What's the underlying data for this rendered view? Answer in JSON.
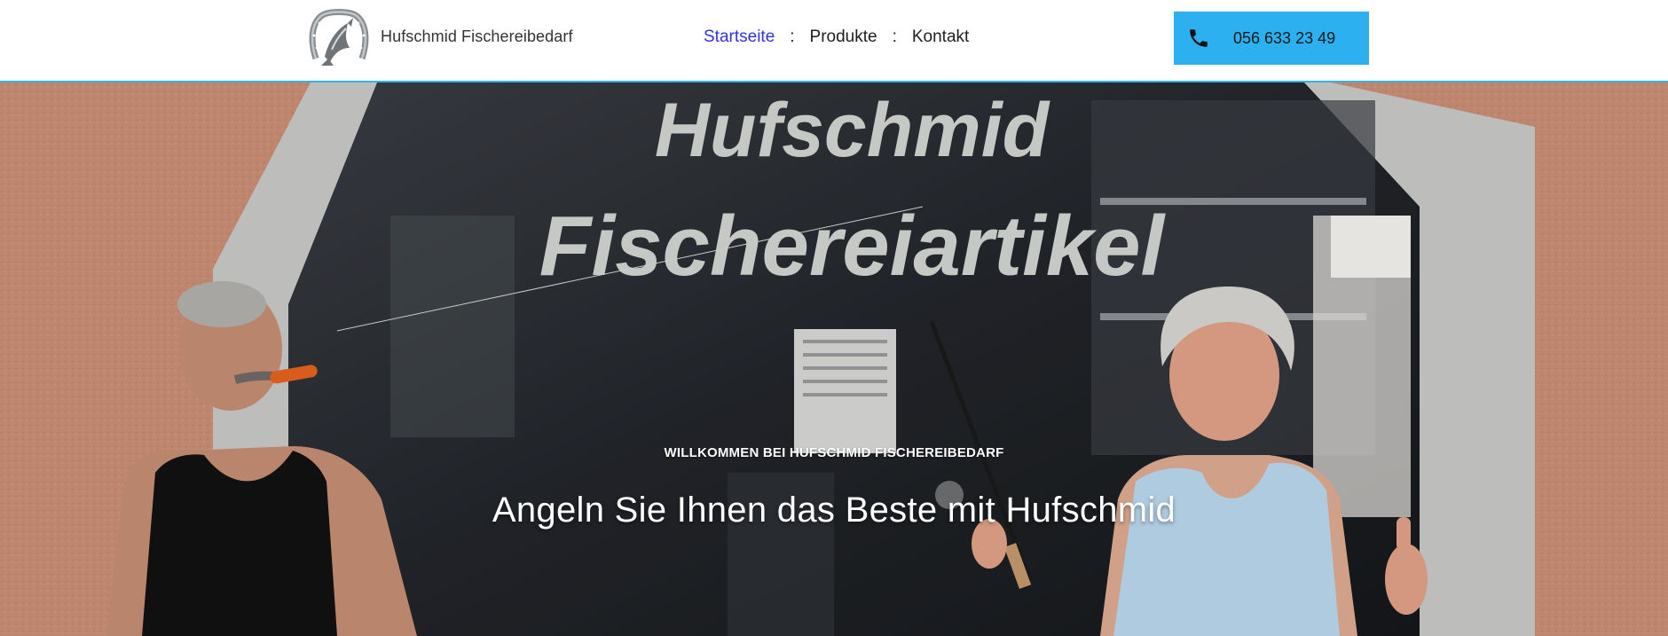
{
  "header": {
    "brand": "Hufschmid Fischereibedarf",
    "logo_icon": "horseshoe-fish-logo-icon",
    "nav": {
      "items": [
        "Startseite",
        "Produkte",
        "Kontakt"
      ],
      "separator": ":",
      "active_index": 0
    },
    "phone": {
      "icon": "phone-icon",
      "number": "056 633 23 49"
    },
    "accent_color": "#2cb0f0",
    "active_link_color": "#3333dd"
  },
  "hero": {
    "kicker": "WILLKOMMEN BEI HUFSCHMID FISCHEREIBEDARF",
    "title": "Angeln Sie Ihnen das Beste mit Hufschmid",
    "window_text_line1": "Hufschmid",
    "window_text_line2": "Fischereiartikel",
    "wall_color": "#cc9077"
  }
}
